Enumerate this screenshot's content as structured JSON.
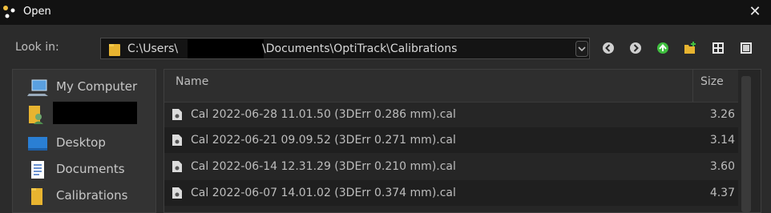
{
  "window": {
    "title": "Open",
    "close_symbol": "✕"
  },
  "lookin": {
    "label": "Look in:",
    "path_prefix": "C:\\Users\\",
    "path_suffix": "\\Documents\\OptiTrack\\Calibrations"
  },
  "toolbar": {
    "icons": [
      "back-icon",
      "forward-icon",
      "up-folder-icon",
      "new-folder-icon",
      "list-view-icon",
      "detail-view-icon"
    ]
  },
  "places": [
    {
      "label": "My Computer",
      "icon": "computer-icon"
    },
    {
      "label": "",
      "icon": "user-folder-icon"
    },
    {
      "label": "Desktop",
      "icon": "desktop-icon"
    },
    {
      "label": "Documents",
      "icon": "documents-icon"
    },
    {
      "label": "Calibrations",
      "icon": "folder-icon"
    }
  ],
  "filelist": {
    "columns": {
      "name": "Name",
      "size": "Size"
    },
    "rows": [
      {
        "name": "Cal 2022-06-28 11.01.50 (3DErr 0.286 mm).cal",
        "size": "3.26"
      },
      {
        "name": "Cal 2022-06-21 09.09.52 (3DErr 0.271 mm).cal",
        "size": "3.14"
      },
      {
        "name": "Cal 2022-06-14 12.31.29 (3DErr 0.210 mm).cal",
        "size": "3.60"
      },
      {
        "name": "Cal 2022-06-07 14.01.02 (3DErr 0.374 mm).cal",
        "size": "4.37"
      }
    ]
  },
  "colors": {
    "titlebar": "#121212",
    "background": "#2b2b2b",
    "folder": "#e8b430",
    "up_arrow": "#3fbf3f"
  }
}
